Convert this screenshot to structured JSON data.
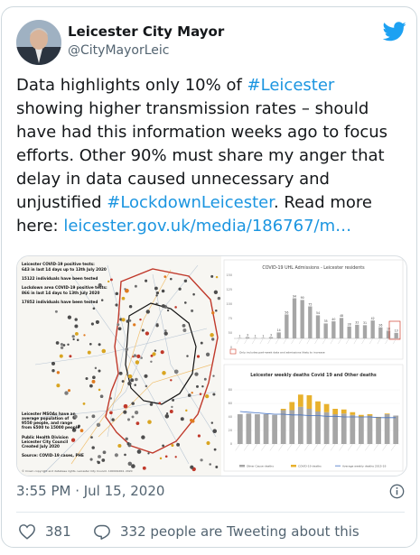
{
  "author": {
    "display_name": "Leicester City Mayor",
    "handle": "@CityMayorLeic"
  },
  "tweet": {
    "text_1": "Data highlights only 10% of ",
    "hashtag_1": "#Leicester",
    "text_2": " showing higher transmission rates – should have had this information weeks ago to focus efforts. Other 90% must share my anger that delay in data caused unnecessary and unjustified ",
    "hashtag_2": "#LockdownLeicester",
    "text_3": ". Read more here: ",
    "link": "leicester.gov.uk/media/186767/m…"
  },
  "media": {
    "map": {
      "stats": [
        "Leicester COVID-19 positive tests:",
        "643 in last 14 days up to 13th July 2020",
        "15122 individuals have been tested",
        "Lockdown area COVID-19 positive tests:",
        "866 in last 14 days to 13th July 2020",
        "17852 individuals have been tested"
      ],
      "notes": [
        "Leicester MSOAs have an",
        "average population of",
        "9550 people, and range",
        "from 6500 to 15000 people",
        "Public Health Division",
        "Leicester City Council",
        "Created July 2020",
        "Source: COVID-19 cases, PHE"
      ],
      "footer": "© Crown copyright and database rights. Leicester City Council. 100019264. 2020"
    },
    "chart_top": {
      "title": "COVID-19 UHL Admissions - Leicester residents",
      "footnote": "Only includes part-week data and admissions likely to increase"
    },
    "chart_bottom": {
      "title": "Leicester weekly deaths Covid 19 and Other deaths",
      "legend": [
        "Other Cause deaths",
        "COVID-19 deaths",
        "Average weekly deaths 2015-19"
      ]
    }
  },
  "chart_data": [
    {
      "type": "bar",
      "title": "COVID-19 UHL Admissions - Leicester residents",
      "values": [
        1,
        3,
        1,
        1,
        3,
        14,
        56,
        94,
        90,
        75,
        54,
        35,
        40,
        48,
        28,
        32,
        31,
        42,
        26,
        18,
        13
      ],
      "ylim": [
        0,
        150
      ],
      "colors": {
        "bar": "#a6a6a6",
        "axis": "#7f7f7f"
      }
    },
    {
      "type": "bar",
      "title": "Leicester weekly deaths Covid 19 and Other deaths",
      "series": [
        {
          "name": "Other Cause deaths",
          "values": [
            44,
            45,
            44,
            44,
            43,
            50,
            50,
            55,
            52,
            48,
            47,
            44,
            45,
            43,
            40,
            42,
            38,
            44,
            42
          ]
        },
        {
          "name": "COVID-19 deaths",
          "values": [
            0,
            0,
            0,
            0,
            0,
            2,
            12,
            18,
            20,
            15,
            12,
            8,
            6,
            4,
            3,
            2,
            2,
            1,
            0
          ]
        },
        {
          "name": "Average weekly deaths 2015-19",
          "values": [
            48,
            47,
            46,
            45,
            44,
            44,
            43,
            43,
            42,
            42,
            41,
            41,
            40,
            40,
            40,
            40,
            39,
            39,
            39
          ]
        }
      ],
      "ylim": [
        0,
        80
      ],
      "colors": {
        "other": "#a6a6a6",
        "covid": "#e8b12d",
        "average": "#4472c4"
      }
    }
  ],
  "footer": {
    "timestamp": "3:55 PM · Jul 15, 2020",
    "likes": "381",
    "replies_text": "332 people are Tweeting about this"
  },
  "colors": {
    "link": "#1b95e0",
    "twitter_blue": "#1da1f2",
    "muted": "#536471"
  }
}
